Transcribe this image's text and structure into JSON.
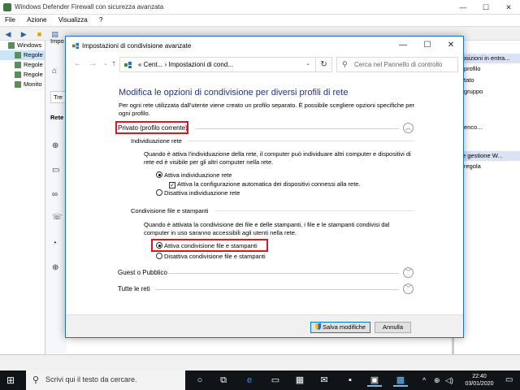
{
  "bg_window": {
    "title": "Windows Defender Firewall con sicurezza avanzata",
    "menu": [
      "File",
      "Azione",
      "Visualizza",
      "?"
    ],
    "tree": [
      "Windows",
      "Regole",
      "Regole",
      "Regole",
      "Monito"
    ],
    "mid_label": "Impo",
    "mid_input": "Tre",
    "mid_label2": "Rete",
    "right_header1": "osizioni in entra...",
    "right_items": [
      "profilo",
      "tato",
      "gruppo"
    ],
    "right_item_mid": "enco...",
    "right_header2": "e gestione W...",
    "right_item_last": "regola"
  },
  "dialog": {
    "title": "Impostazioni di condivisione avanzate",
    "address_path": "«  Cent...  ›  Impostazioni di cond...",
    "search_placeholder": "Cerca nel Pannello di controllo",
    "heading": "Modifica le opzioni di condivisione per diversi profili di rete",
    "intro": "Per ogni rete utilizzata dall'utente viene creato un profilo separato. È possibile scegliere opzioni specifiche per ogni profilo.",
    "profile_private": "Privato (profilo corrente)",
    "network_discovery": {
      "title": "Individuazione rete",
      "description": "Quando è attiva l'individuazione della rete, il computer può individuare altri computer e dispositivi di rete ed è visibile per gli altri computer nella rete.",
      "option_on": "Attiva individuazione rete",
      "auto_config": "Attiva la configurazione automatica dei dispositivi connessi alla rete.",
      "option_off": "Disattiva individuazione rete"
    },
    "file_sharing": {
      "title": "Condivisione file e stampanti",
      "description": "Quando è attivata la condivisione dei file e delle stampanti, i file e le stampanti condivisi dal computer in uso saranno accessibili agli utenti nella rete.",
      "option_on": "Attiva condivisione file e stampanti",
      "option_off": "Disattiva condivisione file e stampanti"
    },
    "profile_guest": "Guest o Pubblico",
    "profile_all": "Tutte le reti",
    "save_button": "Salva modifiche",
    "cancel_button": "Annulla"
  },
  "taskbar": {
    "search_placeholder": "Scrivi qui il testo da cercare.",
    "time": "22:40",
    "date": "03/01/2020"
  },
  "colors": {
    "heading": "#1e3287",
    "highlight": "#e0141b",
    "accent": "#0078d7"
  }
}
